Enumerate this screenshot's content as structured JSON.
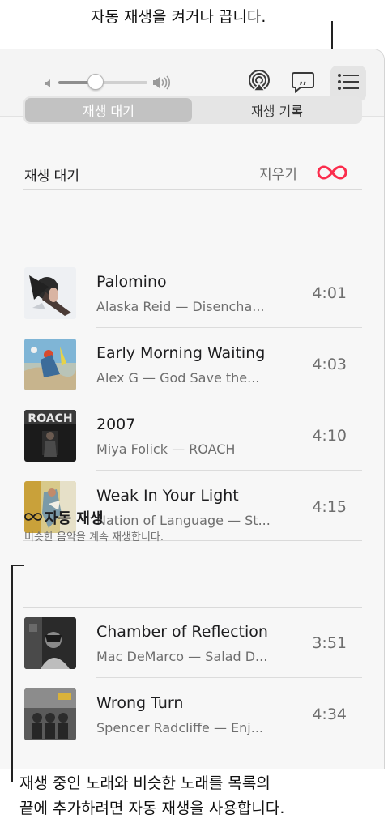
{
  "callouts": {
    "top": "자동 재생을 켜거나 끕니다.",
    "bottom_line1": "재생 중인 노래와 비슷한 노래를 목록의",
    "bottom_line2": "끝에 추가하려면 자동 재생을 사용합니다."
  },
  "toolbar": {
    "volume_level": 0.42,
    "icons": [
      "speaker-low-icon",
      "speaker-high-icon",
      "airplay-icon",
      "lyrics-icon",
      "queue-list-icon"
    ]
  },
  "tabs": [
    {
      "label": "재생 대기",
      "selected": true
    },
    {
      "label": "재생 기록",
      "selected": false
    }
  ],
  "queue": {
    "title": "재생 대기",
    "clear_label": "지우기",
    "autoplay_icon": "infinity-icon",
    "autoplay_color": "#fb2d4d"
  },
  "songs": [
    {
      "title": "Palomino",
      "subtitle": "Alaska Reid — Disencha...",
      "duration": "4:01"
    },
    {
      "title": "Early Morning Waiting",
      "subtitle": "Alex G — God Save the...",
      "duration": "4:03"
    },
    {
      "title": "2007",
      "subtitle": "Miya Folick — ROACH",
      "duration": "4:10"
    },
    {
      "title": "Weak In Your Light",
      "subtitle": "Nation of Language — St...",
      "duration": "4:15"
    }
  ],
  "autoplay": {
    "icon": "infinity-icon",
    "title": "자동 재생",
    "description": "비슷한 음악을 계속 재생합니다.",
    "songs": [
      {
        "title": "Chamber of Reflection",
        "subtitle": "Mac DeMarco — Salad D...",
        "duration": "3:51"
      },
      {
        "title": "Wrong Turn",
        "subtitle": "Spencer Radcliffe — Enj...",
        "duration": "4:34"
      }
    ]
  },
  "album_art": {
    "roach_text": "ROACH"
  }
}
